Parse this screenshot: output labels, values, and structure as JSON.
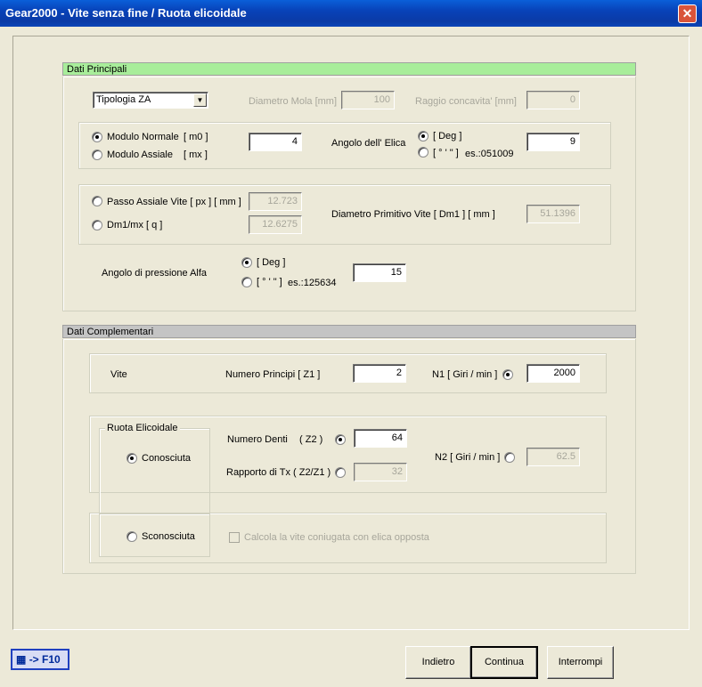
{
  "window": {
    "title": "Gear2000 - Vite senza fine / Ruota elicoidale",
    "close_glyph": "✕"
  },
  "principali": {
    "header": "Dati  Principali",
    "tipologia": {
      "value": "Tipologia ZA"
    },
    "diametro_mola": {
      "label": "Diametro Mola [mm]",
      "value": "100"
    },
    "raggio_concavita": {
      "label": "Raggio concavita' [mm]",
      "value": "0"
    },
    "modulo_normale_label": "Modulo Normale",
    "modulo_normale_unit": "[ m0 ]",
    "modulo_assiale_label": "Modulo Assiale",
    "modulo_assiale_unit": "[ mx ]",
    "modulo_value": "4",
    "angolo_elica_label": "Angolo dell' Elica",
    "deg_label": "[ Deg ]",
    "dms_label": "[ ° ' \" ]",
    "elica_example": "es.:051009",
    "angolo_elica_value": "9",
    "passo_assiale_label": "Passo Assiale Vite [ px ] [ mm ]",
    "passo_assiale_value": "12.723",
    "dm1_label": "Dm1/mx [ q ]",
    "dm1_value": "12.6275",
    "diametro_primitivo_label": "Diametro Primitivo Vite [ Dm1 ] [ mm ]",
    "diametro_primitivo_value": "51.1396",
    "pressione_label": "Angolo di pressione Alfa",
    "pressione_example": "es.:125634",
    "pressione_value": "15"
  },
  "complementari": {
    "header": "Dati Complementari",
    "vite_label": "Vite",
    "numero_principi_label": "Numero Principi  [ Z1 ]",
    "numero_principi_value": "2",
    "n1_label": "N1 [ Giri / min ]",
    "n1_value": "2000",
    "ruota_group_label": "Ruota Elicoidale",
    "conosciuta_label": "Conosciuta",
    "numero_denti_label": "Numero Denti",
    "numero_denti_unit": "( Z2 )",
    "numero_denti_value": "64",
    "rapporto_label": "Rapporto di Tx ( Z2/Z1 )",
    "rapporto_value": "32",
    "n2_label": "N2 [ Giri / min ]",
    "n2_value": "62.5",
    "sconosciuta_label": "Sconosciuta",
    "calcola_label": "Calcola la vite coniugata con elica opposta"
  },
  "footer": {
    "calc_label": "-> F10",
    "indietro": "Indietro",
    "continua": "Continua",
    "interrompi": "Interrompi"
  },
  "icons": [
    "close-icon",
    "calculator-icon",
    "dropdown-arrow-icon"
  ]
}
